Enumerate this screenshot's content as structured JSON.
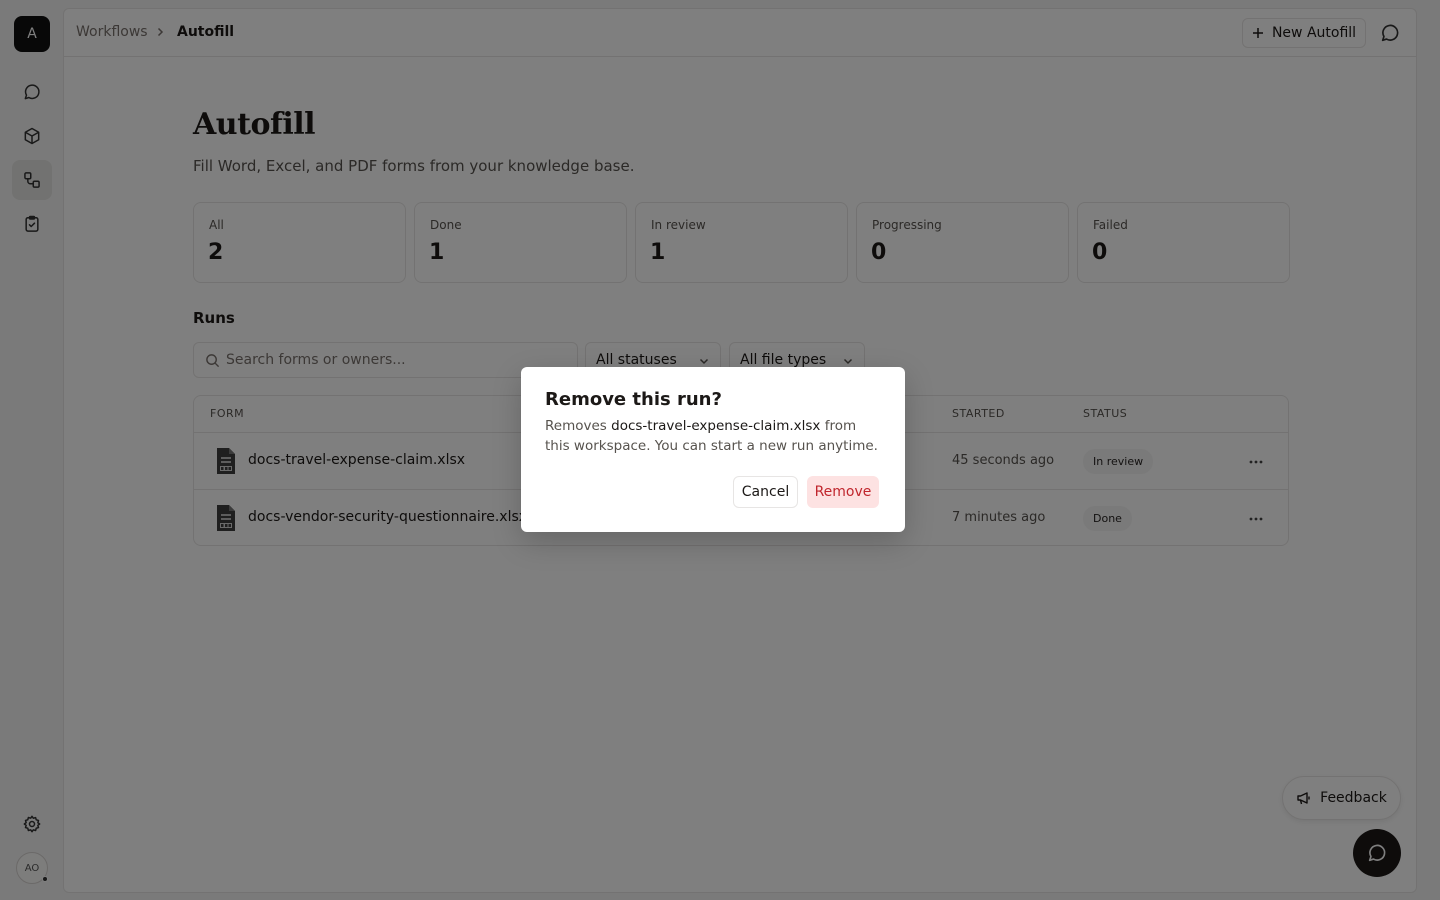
{
  "rail": {
    "logo_letter": "A",
    "items": [
      {
        "name": "chat",
        "icon": "chat-bubble-icon"
      },
      {
        "name": "vault",
        "icon": "cube-icon"
      },
      {
        "name": "workflows",
        "icon": "workflow-icon",
        "active": true
      },
      {
        "name": "tasks",
        "icon": "clipboard-check-icon"
      }
    ],
    "settings_icon": "gear-icon",
    "avatar_initials": "AO"
  },
  "topbar": {
    "breadcrumb": [
      "Workflows",
      "Autofill"
    ],
    "new_button_label": "New Autofill"
  },
  "page": {
    "title": "Autofill",
    "subtitle": "Fill Word, Excel, and PDF forms from your knowledge base."
  },
  "stats": [
    {
      "label": "All",
      "value": "2"
    },
    {
      "label": "Done",
      "value": "1"
    },
    {
      "label": "In review",
      "value": "1"
    },
    {
      "label": "Progressing",
      "value": "0"
    },
    {
      "label": "Failed",
      "value": "0"
    }
  ],
  "runs": {
    "heading": "Runs",
    "search_placeholder": "Search forms or owners...",
    "status_filter": "All statuses",
    "type_filter": "All file types",
    "columns": [
      "FORM",
      "STARTED",
      "STATUS"
    ],
    "rows": [
      {
        "form": "docs-travel-expense-claim.xlsx",
        "started": "45 seconds ago",
        "status": "In review"
      },
      {
        "form": "docs-vendor-security-questionnaire.xlsx",
        "started": "7 minutes ago",
        "status": "Done"
      }
    ]
  },
  "feedback_label": "Feedback",
  "dialog": {
    "title": "Remove this run?",
    "body_prefix": "Removes",
    "file_name": "docs-travel-expense-claim.xlsx",
    "body_suffix": "from this workspace. You can start a new run anytime.",
    "cancel_label": "Cancel",
    "remove_label": "Remove"
  }
}
